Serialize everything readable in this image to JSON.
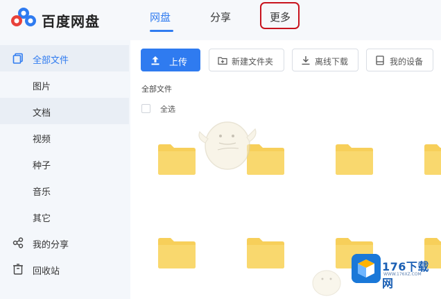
{
  "header": {
    "brand": "百度网盘",
    "tabs": [
      {
        "label": "网盘",
        "active": true
      },
      {
        "label": "分享",
        "active": false
      },
      {
        "label": "更多",
        "active": false
      }
    ]
  },
  "sidebar": {
    "items": [
      {
        "label": "全部文件",
        "icon": "all-files-icon",
        "selected": true
      },
      {
        "label": "图片",
        "icon": "",
        "selected": false
      },
      {
        "label": "文档",
        "icon": "",
        "selected": true
      },
      {
        "label": "视频",
        "icon": "",
        "selected": false
      },
      {
        "label": "种子",
        "icon": "",
        "selected": false
      },
      {
        "label": "音乐",
        "icon": "",
        "selected": false
      },
      {
        "label": "其它",
        "icon": "",
        "selected": false
      },
      {
        "label": "我的分享",
        "icon": "share-icon",
        "selected": false
      },
      {
        "label": "回收站",
        "icon": "trash-icon",
        "selected": false
      }
    ]
  },
  "toolbar": {
    "upload_label": "上传",
    "new_folder_label": "新建文件夹",
    "offline_download_label": "离线下载",
    "my_devices_label": "我的设备"
  },
  "content": {
    "breadcrumb": "全部文件",
    "select_all_label": "全选"
  },
  "watermark": {
    "title": "176下载网",
    "url": "WWW.176XZ.COM"
  },
  "colors": {
    "accent": "#2f7bf0",
    "folder": "#f7cf5a",
    "highlight_box": "#c8121d"
  }
}
